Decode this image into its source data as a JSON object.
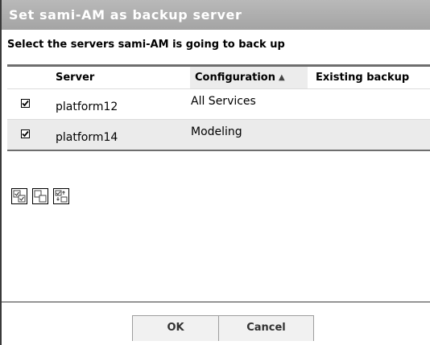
{
  "dialog": {
    "title": "Set sami-AM as backup server",
    "instruction": "Select the servers sami-AM is going to back up"
  },
  "table": {
    "columns": {
      "server": "Server",
      "configuration": "Configuration",
      "existing_backup": "Existing backup",
      "sort_indicator": "▲"
    },
    "rows": [
      {
        "checked": true,
        "server": "platform12",
        "configuration": "All Services"
      },
      {
        "checked": true,
        "server": "platform14",
        "configuration": "Modeling"
      }
    ]
  },
  "toolbar": {
    "icons": [
      "select-all-icon",
      "clear-all-icon",
      "invert-selection-icon"
    ]
  },
  "buttons": {
    "ok": "OK",
    "cancel": "Cancel"
  },
  "colors": {
    "title_bar": "#a9a9a9",
    "even_row": "#ebebeb"
  }
}
